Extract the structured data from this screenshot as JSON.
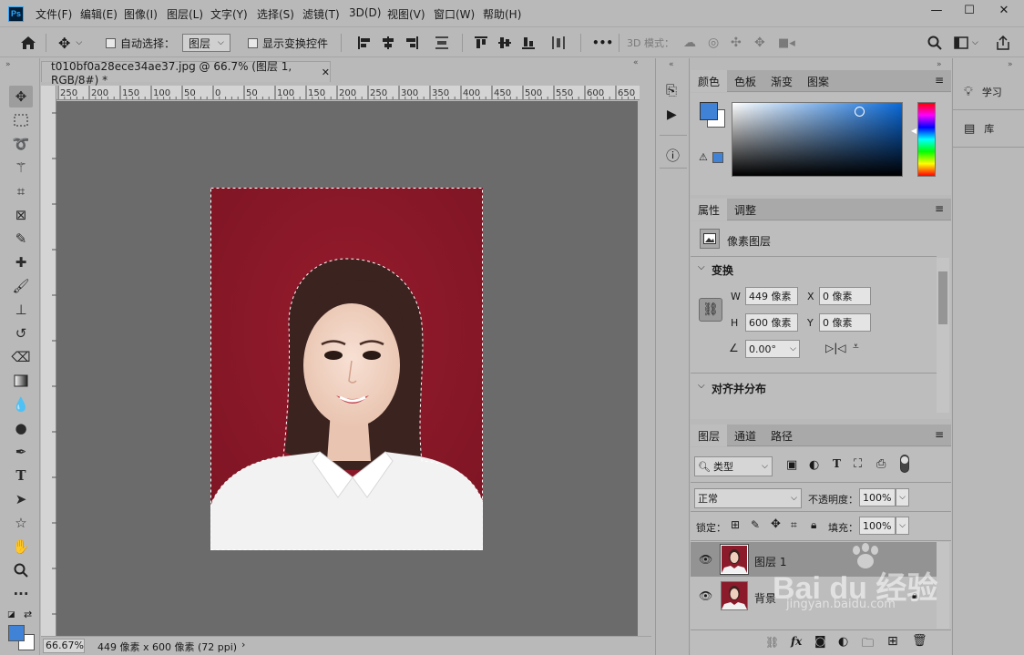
{
  "menu": {
    "logo": "Ps",
    "items": [
      "文件(F)",
      "编辑(E)",
      "图像(I)",
      "图层(L)",
      "文字(Y)",
      "选择(S)",
      "滤镜(T)",
      "3D(D)",
      "视图(V)",
      "窗口(W)",
      "帮助(H)"
    ],
    "window_controls": {
      "min": "—",
      "max": "☐",
      "close": "✕"
    }
  },
  "options": {
    "auto_select_label": "自动选择：",
    "auto_select_value": "图层",
    "show_transform_label": "显示变换控件",
    "more": "•••",
    "mode_3d": "3D 模式："
  },
  "document": {
    "tab_title": "t010bf0a28ece34ae37.jpg @ 66.7% (图层 1, RGB/8#) *",
    "ruler_labels": [
      "250",
      "200",
      "150",
      "100",
      "50",
      "0",
      "50",
      "100",
      "150",
      "200",
      "250",
      "300",
      "350",
      "400",
      "450",
      "500",
      "550",
      "600",
      "650"
    ]
  },
  "status": {
    "zoom": "66.67%",
    "info": "449 像素 x 600 像素 (72 ppi)",
    "arrow": "›"
  },
  "color_panel": {
    "tabs": [
      "颜色",
      "色板",
      "渐变",
      "图案"
    ],
    "foreground": "#3f82d6",
    "background": "#ffffff"
  },
  "properties_panel": {
    "tabs": [
      "属性",
      "调整"
    ],
    "type_label": "像素图层",
    "transform_title": "变换",
    "w_label": "W",
    "w_value": "449 像素",
    "h_label": "H",
    "h_value": "600 像素",
    "x_label": "X",
    "x_value": "0 像素",
    "y_label": "Y",
    "y_value": "0 像素",
    "angle_value": "0.00°",
    "align_title": "对齐并分布"
  },
  "layers_panel": {
    "tabs": [
      "图层",
      "通道",
      "路径"
    ],
    "filter_label": "类型",
    "blend_mode": "正常",
    "opacity_label": "不透明度：",
    "opacity_value": "100%",
    "lock_label": "锁定：",
    "fill_label": "填充：",
    "fill_value": "100%",
    "layers": [
      {
        "name": "图层 1",
        "selected": true
      },
      {
        "name": "背景",
        "selected": false
      }
    ]
  },
  "right_strip": {
    "learn": "学习",
    "library": "库"
  },
  "watermark": {
    "brand": "Bai du 经验",
    "url": "jingyan.baidu.com"
  }
}
